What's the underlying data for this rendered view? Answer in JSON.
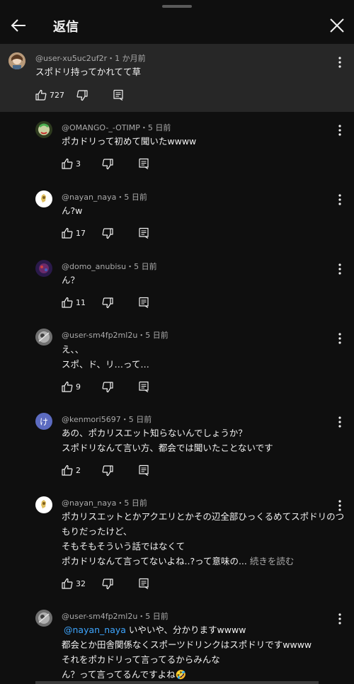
{
  "header": {
    "title": "返信"
  },
  "parent": {
    "meta": "@user-xu5uc2uf2r・1 か月前",
    "text": "スポドリ持ってかれてて草",
    "likes": "727"
  },
  "replies": [
    {
      "meta": "@OMANGO-_-OTIMP・5 日前",
      "lines": [
        "ポカドリって初めて聞いたwwww"
      ],
      "likes": "3"
    },
    {
      "meta": "@nayan_naya・5 日前",
      "lines": [
        "ん?w"
      ],
      "likes": "17"
    },
    {
      "meta": "@domo_anubisu・5 日前",
      "lines": [
        "ん？"
      ],
      "likes": "11"
    },
    {
      "meta": "@user-sm4fp2ml2u・5 日前",
      "lines": [
        "え、、",
        "スポ、ド、リ…って…"
      ],
      "likes": "9"
    },
    {
      "meta": "@kenmori5697・5 日前",
      "avatar_letter": "け",
      "lines": [
        "あの、ポカリスエット知らないんでしょうか？",
        "スポドリなんて言い方、都会では聞いたことないです"
      ],
      "likes": "2"
    },
    {
      "meta": "@nayan_naya・5 日前",
      "lines": [
        "ポカリスエットとかアクエリとかその辺全部ひっくるめてスポドリのつ",
        "もりだったけど、",
        "そもそもそういう話ではなくて",
        "ポカドリなんて言ってないよね..?って意味の..."
      ],
      "read_more": "続きを読む",
      "likes": "32"
    },
    {
      "meta": "@user-sm4fp2ml2u・5 日前",
      "mention": "@nayan_naya",
      "first_line_rest": " いやいや、分かりますwwww",
      "lines": [
        "都会とか田舎関係なくスポーツドリンクはスポドリですwwww",
        "それをポカドリって言ってるからみんな",
        "ん？って言ってるんですよね🤣"
      ]
    }
  ],
  "colors": {
    "background": "#0f0f0f",
    "parent_bg": "#272727",
    "mention": "#3ea6ff",
    "avatar_letter_bg": "#5c6bc0"
  },
  "icons": [
    "back-arrow-icon",
    "close-icon",
    "more-vert-icon",
    "like-icon",
    "dislike-icon",
    "reply-icon"
  ]
}
